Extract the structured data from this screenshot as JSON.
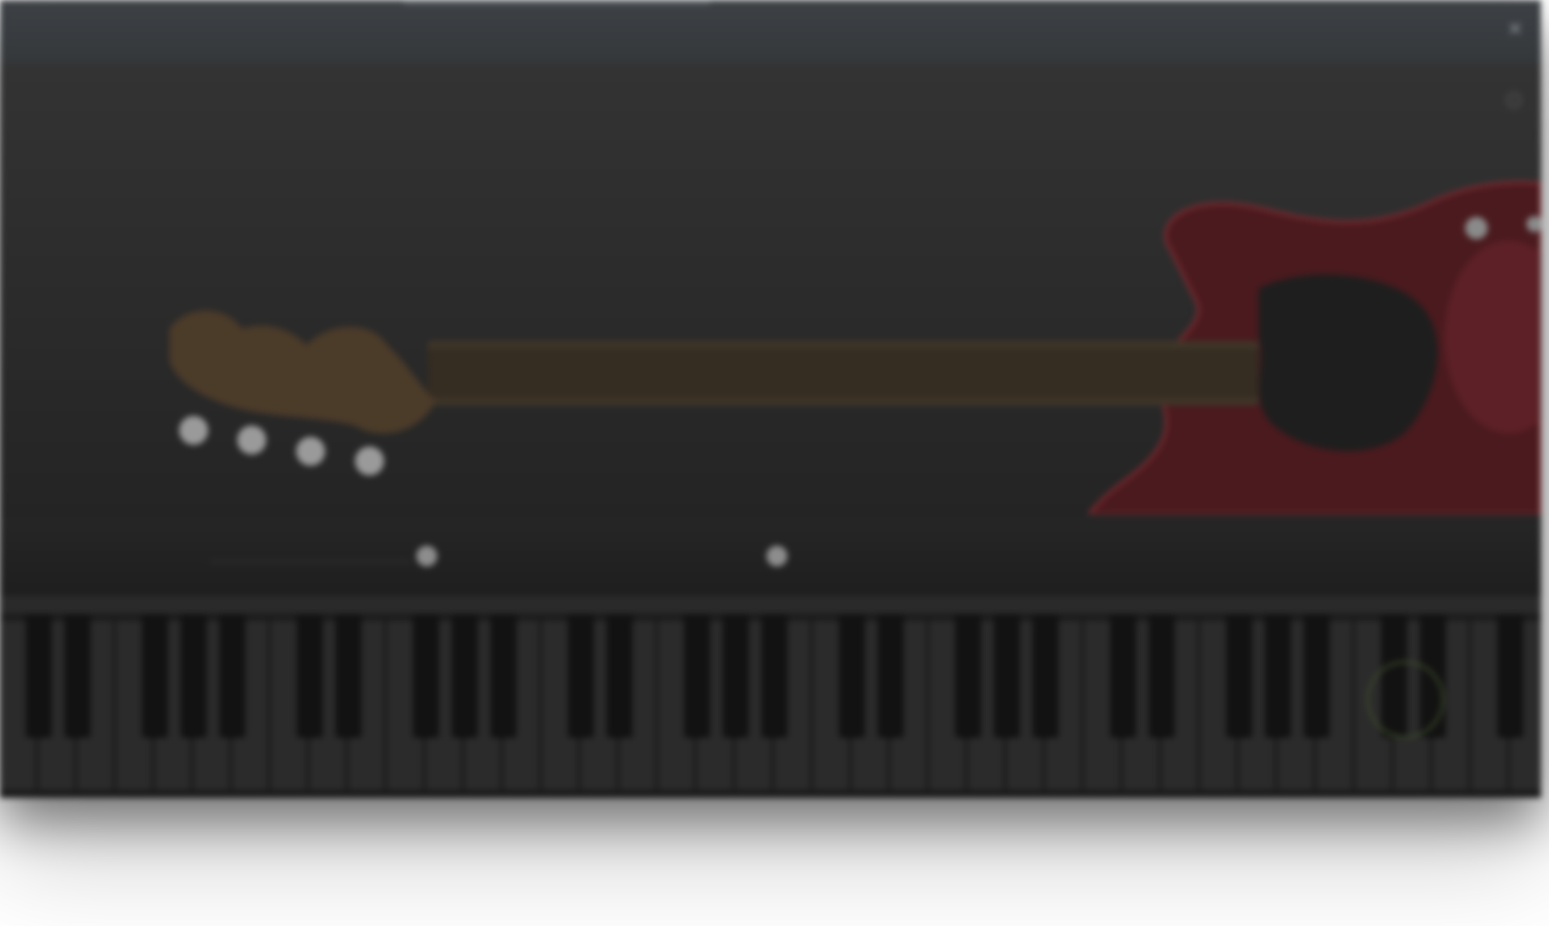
{
  "window": {
    "title": "",
    "menu_label": "",
    "close_label": "✕"
  },
  "stage": {
    "logo_text": "",
    "settings_icon": "gear-icon"
  },
  "instrument": {
    "body_color": "#5a1e22",
    "neck_color": "#3f3528",
    "tuner_color": "#9a9a9a"
  },
  "controls": {
    "items": [
      "",
      "",
      "",
      "",
      "",
      "",
      ""
    ]
  },
  "keyboard": {
    "white_key_color": "#2b2b2b",
    "black_key_color": "#121212"
  }
}
